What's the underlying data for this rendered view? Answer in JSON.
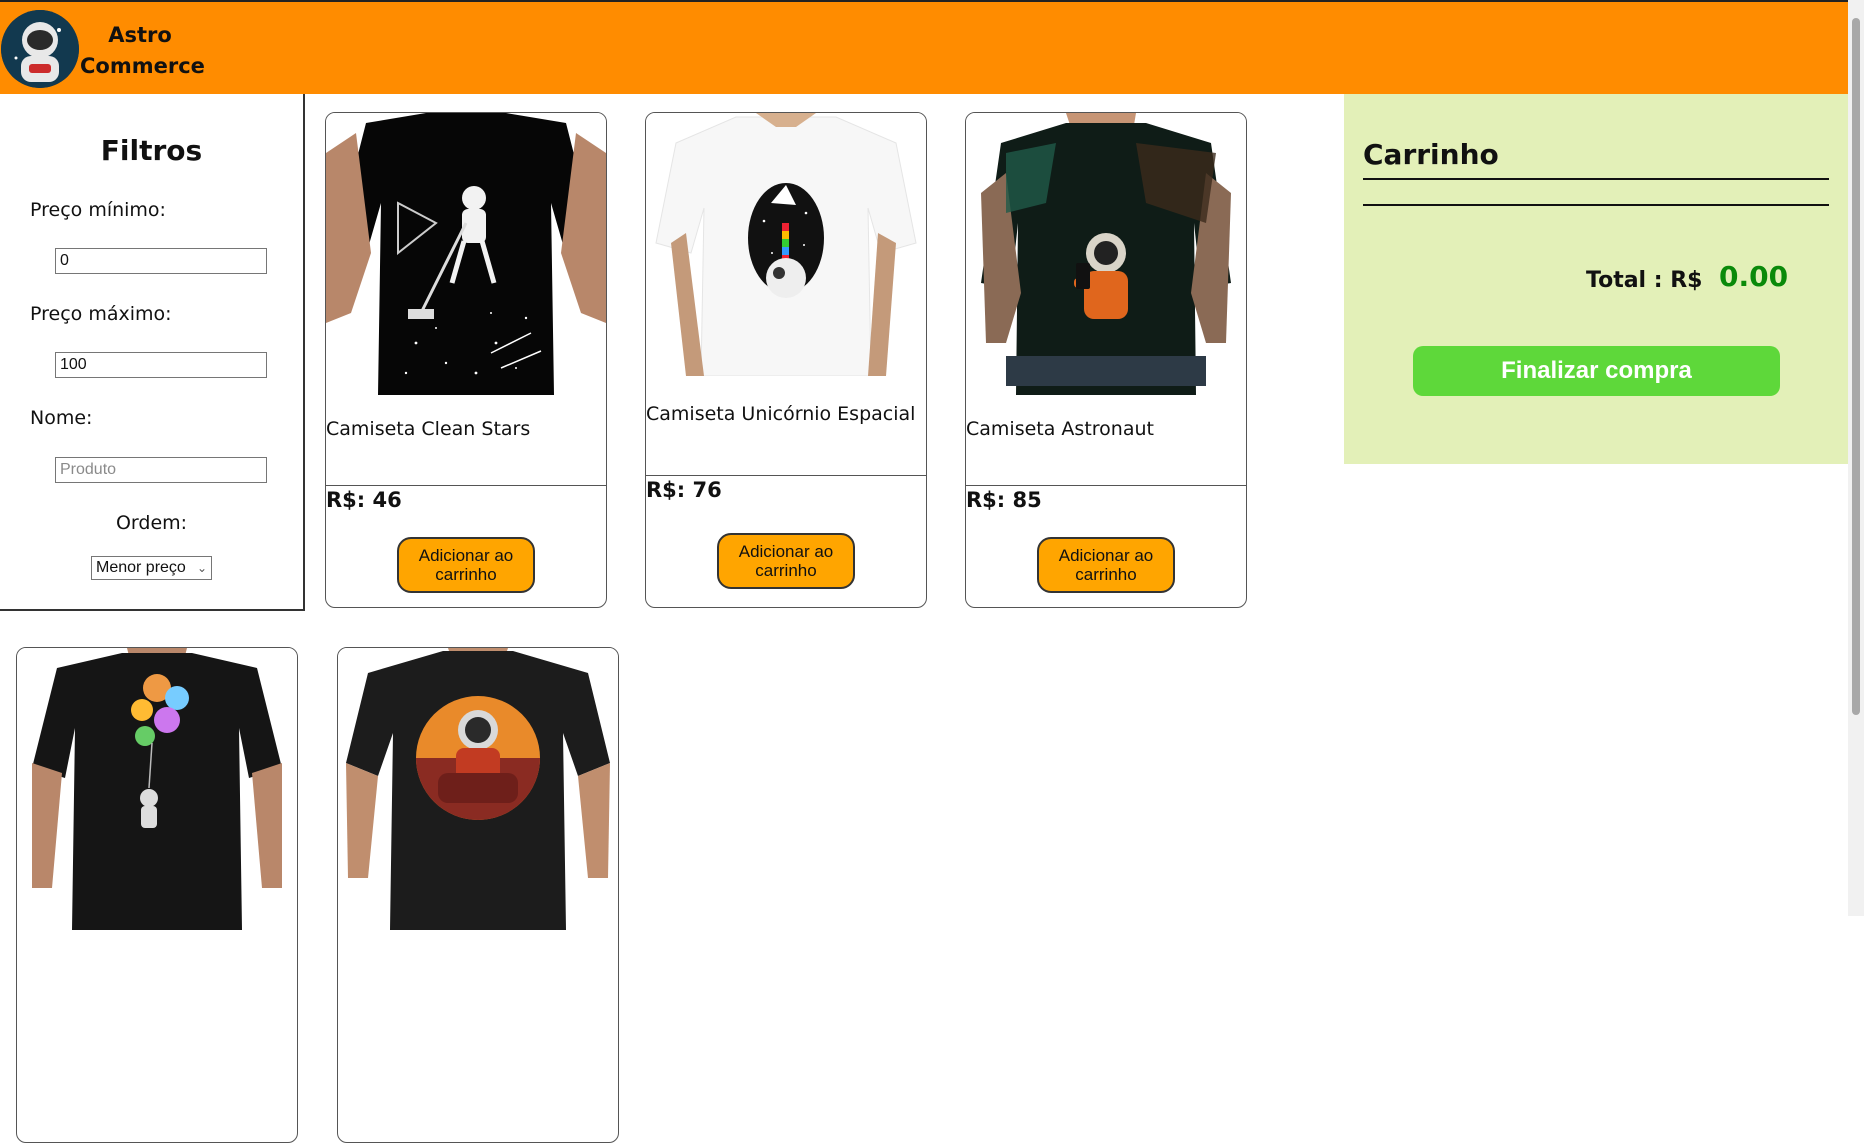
{
  "header": {
    "brand_line1": "Astro",
    "brand_line2": "Commerce",
    "bg_color": "#ff8c00"
  },
  "filters": {
    "title": "Filtros",
    "min_price_label": "Preço mínimo:",
    "min_price_value": "0",
    "max_price_label": "Preço máximo:",
    "max_price_value": "100",
    "name_label": "Nome:",
    "name_placeholder": "Produto",
    "order_label": "Ordem:",
    "order_selected": "Menor preço"
  },
  "products": [
    {
      "name": "Camiseta Clean Stars",
      "price": "R$: 46",
      "button_line1": "Adicionar ao",
      "button_line2": "carrinho",
      "shirt_color": "#000000",
      "print": "astronaut-vacuum"
    },
    {
      "name": "Camiseta Unicórnio Espacial",
      "price": "R$: 76",
      "button_line1": "Adicionar ao",
      "button_line2": "carrinho",
      "shirt_color": "#ffffff",
      "print": "unicorn-space"
    },
    {
      "name": "Camiseta Astronaut",
      "price": "R$: 85",
      "button_line1": "Adicionar ao",
      "button_line2": "carrinho",
      "shirt_color": "#111a14",
      "print": "astronaut-phone"
    },
    {
      "name": "",
      "price": "",
      "button_line1": "",
      "button_line2": "",
      "shirt_color": "#151515",
      "print": "astronaut-balloons"
    },
    {
      "name": "",
      "price": "",
      "button_line1": "",
      "button_line2": "",
      "shirt_color": "#1c1c1c",
      "print": "astronaut-sunset"
    }
  ],
  "cart": {
    "title": "Carrinho",
    "total_label": "Total : R$",
    "total_value": "0.00",
    "checkout_label": "Finalizar compra",
    "bg_color": "#e3f0b8",
    "checkout_color": "#5ed83a"
  }
}
